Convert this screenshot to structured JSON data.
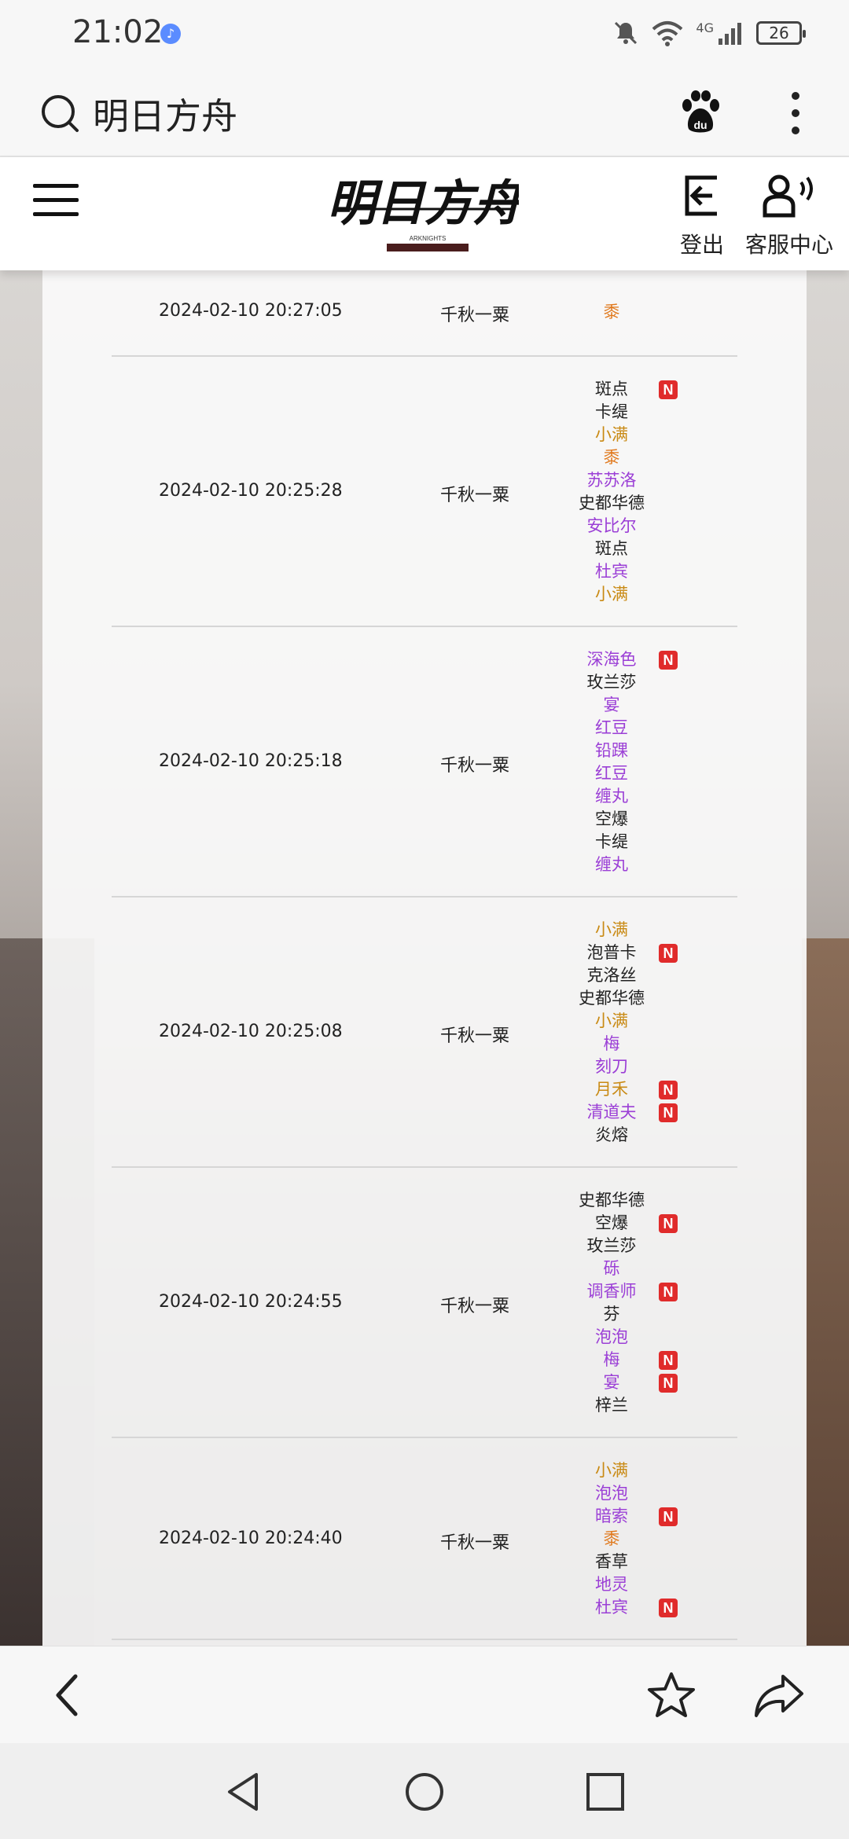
{
  "status_bar": {
    "time": "21:02",
    "network": "4G",
    "battery": "26"
  },
  "browser": {
    "search_query": "明日方舟"
  },
  "header": {
    "logout_label": "登出",
    "service_label": "客服中心"
  },
  "colors": {
    "six_star": "#e0781b",
    "five_star": "#c98a14",
    "four_star": "#9b3fd6",
    "three_star": "#222222",
    "new_badge": "#e02b2b"
  },
  "records": [
    {
      "time": "2024-02-10 20:27:05",
      "user": "千秋一粟",
      "ops": [
        {
          "name": "黍",
          "rarity": 6,
          "new": false
        }
      ]
    },
    {
      "time": "2024-02-10 20:25:28",
      "user": "千秋一粟",
      "ops": [
        {
          "name": "斑点",
          "rarity": 3,
          "new": true
        },
        {
          "name": "卡缇",
          "rarity": 3,
          "new": false
        },
        {
          "name": "小满",
          "rarity": 5,
          "new": false
        },
        {
          "name": "黍",
          "rarity": 6,
          "new": false
        },
        {
          "name": "苏苏洛",
          "rarity": 4,
          "new": false
        },
        {
          "name": "史都华德",
          "rarity": 3,
          "new": false
        },
        {
          "name": "安比尔",
          "rarity": 4,
          "new": false
        },
        {
          "name": "斑点",
          "rarity": 3,
          "new": false
        },
        {
          "name": "杜宾",
          "rarity": 4,
          "new": false
        },
        {
          "name": "小满",
          "rarity": 5,
          "new": false
        }
      ]
    },
    {
      "time": "2024-02-10 20:25:18",
      "user": "千秋一粟",
      "ops": [
        {
          "name": "深海色",
          "rarity": 4,
          "new": true
        },
        {
          "name": "玫兰莎",
          "rarity": 3,
          "new": false
        },
        {
          "name": "宴",
          "rarity": 4,
          "new": false
        },
        {
          "name": "红豆",
          "rarity": 4,
          "new": false
        },
        {
          "name": "铅踝",
          "rarity": 4,
          "new": false
        },
        {
          "name": "红豆",
          "rarity": 4,
          "new": false
        },
        {
          "name": "缠丸",
          "rarity": 4,
          "new": false
        },
        {
          "name": "空爆",
          "rarity": 3,
          "new": false
        },
        {
          "name": "卡缇",
          "rarity": 3,
          "new": false
        },
        {
          "name": "缠丸",
          "rarity": 4,
          "new": false
        }
      ]
    },
    {
      "time": "2024-02-10 20:25:08",
      "user": "千秋一粟",
      "ops": [
        {
          "name": "小满",
          "rarity": 5,
          "new": false
        },
        {
          "name": "泡普卡",
          "rarity": 3,
          "new": true
        },
        {
          "name": "克洛丝",
          "rarity": 3,
          "new": false
        },
        {
          "name": "史都华德",
          "rarity": 3,
          "new": false
        },
        {
          "name": "小满",
          "rarity": 5,
          "new": false
        },
        {
          "name": "梅",
          "rarity": 4,
          "new": false
        },
        {
          "name": "刻刀",
          "rarity": 4,
          "new": false
        },
        {
          "name": "月禾",
          "rarity": 5,
          "new": true
        },
        {
          "name": "清道夫",
          "rarity": 4,
          "new": true
        },
        {
          "name": "炎熔",
          "rarity": 3,
          "new": false
        }
      ]
    },
    {
      "time": "2024-02-10 20:24:55",
      "user": "千秋一粟",
      "ops": [
        {
          "name": "史都华德",
          "rarity": 3,
          "new": false
        },
        {
          "name": "空爆",
          "rarity": 3,
          "new": true
        },
        {
          "name": "玫兰莎",
          "rarity": 3,
          "new": false
        },
        {
          "name": "砾",
          "rarity": 4,
          "new": false
        },
        {
          "name": "调香师",
          "rarity": 4,
          "new": true
        },
        {
          "name": "芬",
          "rarity": 3,
          "new": false
        },
        {
          "name": "泡泡",
          "rarity": 4,
          "new": false
        },
        {
          "name": "梅",
          "rarity": 4,
          "new": true
        },
        {
          "name": "宴",
          "rarity": 4,
          "new": true
        },
        {
          "name": "梓兰",
          "rarity": 3,
          "new": false
        }
      ]
    },
    {
      "time": "2024-02-10 20:24:40",
      "user": "千秋一粟",
      "ops": [
        {
          "name": "小满",
          "rarity": 5,
          "new": false
        },
        {
          "name": "泡泡",
          "rarity": 4,
          "new": false
        },
        {
          "name": "暗索",
          "rarity": 4,
          "new": true
        },
        {
          "name": "黍",
          "rarity": 6,
          "new": false
        },
        {
          "name": "香草",
          "rarity": 3,
          "new": false
        },
        {
          "name": "地灵",
          "rarity": 4,
          "new": false
        },
        {
          "name": "杜宾",
          "rarity": 4,
          "new": true
        }
      ]
    }
  ]
}
